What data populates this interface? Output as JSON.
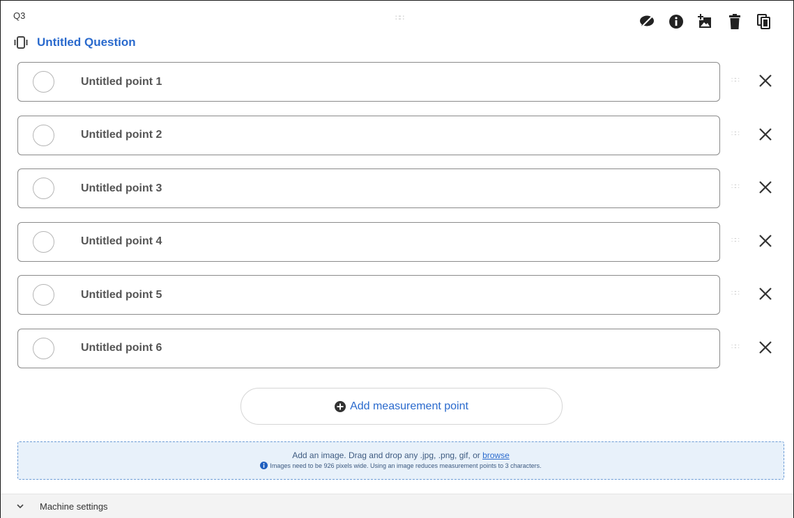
{
  "question": {
    "number": "Q3",
    "title": "Untitled Question",
    "drag_glyph": "∷∷"
  },
  "toolbar": {
    "icons": [
      "hide-comment-icon",
      "info-icon",
      "add-image-icon",
      "trash-icon",
      "copy-icon"
    ]
  },
  "points": [
    {
      "label": "Untitled point 1"
    },
    {
      "label": "Untitled point 2"
    },
    {
      "label": "Untitled point 3"
    },
    {
      "label": "Untitled point 4"
    },
    {
      "label": "Untitled point 5"
    },
    {
      "label": "Untitled point 6"
    }
  ],
  "add_point": {
    "label": "Add measurement point"
  },
  "image_drop": {
    "text": "Add an image. Drag and drop any .jpg, .png, gif, or ",
    "browse_link": "browse",
    "hint": "Images need to be 926 pixels wide. Using an image reduces measurement points to 3 characters."
  },
  "machine_settings": {
    "label": "Machine settings"
  },
  "colors": {
    "accent": "#2a6acd",
    "dropzone_bg": "#e8f1fa",
    "dropzone_border": "#6b9bd6",
    "footer_bg": "#f3f3f3"
  }
}
